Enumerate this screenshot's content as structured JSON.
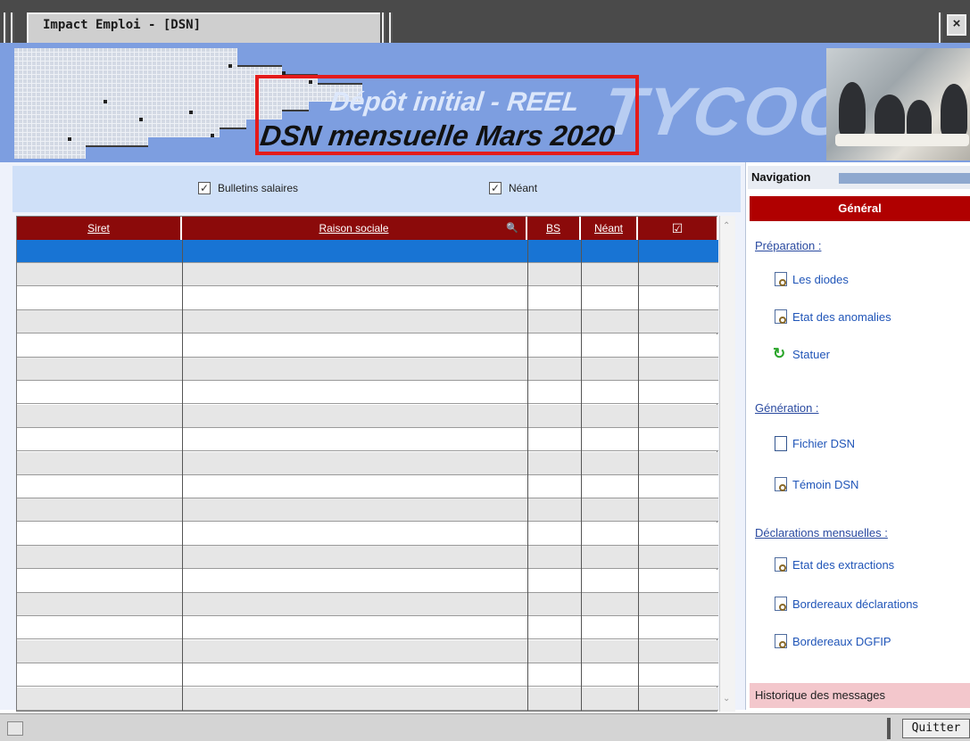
{
  "window": {
    "title": "Impact Emploi - [DSN]",
    "close_glyph": "×"
  },
  "banner": {
    "brand": "TYCOON",
    "deposit": "Dépôt initial - REEL",
    "period": "DSN mensuelle Mars 2020"
  },
  "filters": {
    "bulletins": {
      "label": "Bulletins salaires",
      "checked": true
    },
    "neant": {
      "label": "Néant",
      "checked": true
    }
  },
  "table": {
    "columns": [
      "Siret",
      "Raison sociale",
      "BS",
      "Néant",
      "☑"
    ],
    "row_count": 20,
    "selected_row": 0
  },
  "navigation": {
    "title": "Navigation",
    "general": "Général",
    "sections": [
      {
        "title": "Préparation :",
        "items": [
          {
            "label": "Les diodes",
            "icon": "document-search-icon"
          },
          {
            "label": "Etat des anomalies",
            "icon": "document-search-icon"
          },
          {
            "label": "Statuer",
            "icon": "refresh-icon"
          }
        ]
      },
      {
        "title": "Génération :",
        "items": [
          {
            "label": "Fichier DSN",
            "icon": "file-icon"
          },
          {
            "label": "Témoin DSN",
            "icon": "document-search-icon"
          }
        ]
      },
      {
        "title": "Déclarations mensuelles :",
        "items": [
          {
            "label": "Etat des extractions",
            "icon": "document-search-icon"
          },
          {
            "label": "Bordereaux déclarations",
            "icon": "document-search-icon"
          },
          {
            "label": "Bordereaux DGFIP",
            "icon": "document-search-icon"
          }
        ]
      }
    ],
    "history": "Historique des messages"
  },
  "statusbar": {
    "quit": "Quitter"
  },
  "colors": {
    "header_red": "#8b0a0a",
    "selected_row": "#1874d4",
    "banner_blue": "#7d9ee0"
  }
}
